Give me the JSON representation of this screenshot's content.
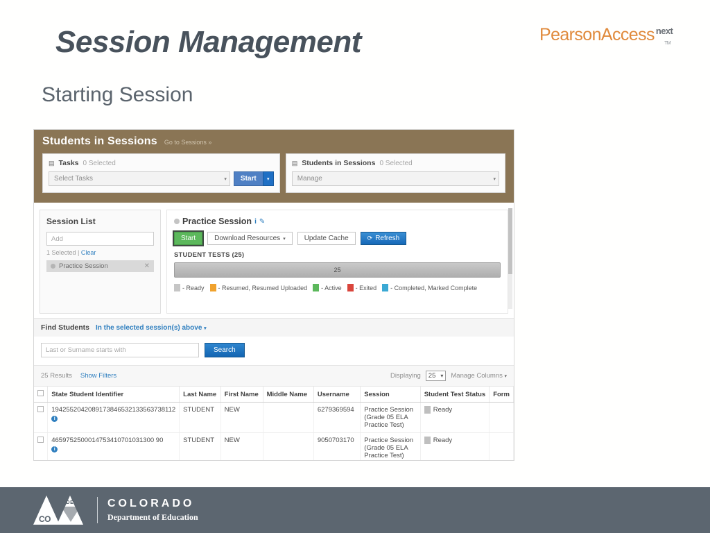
{
  "slide": {
    "title": "Session Management",
    "subtitle": "Starting Session"
  },
  "brand": {
    "pearson_word": "PearsonAccess",
    "pearson_next": "next",
    "pearson_tm": "TM",
    "accent_color": "#e08a3c"
  },
  "app": {
    "header": {
      "title": "Students in Sessions",
      "go_to_sessions": "Go to Sessions »",
      "tasks_panel": {
        "icon": "tasks-icon",
        "label": "Tasks",
        "selected_count": "0 Selected",
        "select_value": "Select Tasks",
        "start_label": "Start",
        "caret": "▾"
      },
      "sis_panel": {
        "icon": "card-icon",
        "label": "Students in Sessions",
        "selected_count": "0 Selected",
        "manage_value": "Manage",
        "caret": "▾"
      }
    },
    "session_list": {
      "title": "Session List",
      "add_placeholder": "Add",
      "selected_text": "1 Selected |",
      "clear_label": "Clear",
      "chip": {
        "label": "Practice Session",
        "remove": "✕"
      }
    },
    "session_detail": {
      "name": "Practice Session",
      "info_icon": "i",
      "edit_icon": "✎",
      "buttons": {
        "start": "Start",
        "download_resources": "Download Resources",
        "update_cache": "Update Cache",
        "refresh": "Refresh",
        "refresh_icon": "⟳",
        "caret": "▾"
      },
      "student_tests_label": "STUDENT TESTS (25)",
      "status_bar_value": "25",
      "legend": [
        {
          "color": "#c6c6c6",
          "label": "- Ready"
        },
        {
          "color": "#f0a22e",
          "label": "- Resumed, Resumed Uploaded"
        },
        {
          "color": "#5cb85c",
          "label": "- Active"
        },
        {
          "color": "#d9453c",
          "label": "- Exited"
        },
        {
          "color": "#3ba9d4",
          "label": "- Completed, Marked Complete"
        }
      ]
    },
    "find_students": {
      "title": "Find Students",
      "scope": "In the selected session(s) above",
      "caret": "▾",
      "search_placeholder": "Last or Surname starts with",
      "search_button": "Search",
      "results_count": "25 Results",
      "show_filters": "Show Filters",
      "displaying_label": "Displaying",
      "displaying_value": "25",
      "displaying_caret": "▾",
      "manage_columns": "Manage Columns",
      "manage_columns_caret": "▾"
    },
    "table": {
      "columns": [
        "State Student Identifier",
        "Last Name",
        "First Name",
        "Middle Name",
        "Username",
        "Session",
        "Student Test Status",
        "Form"
      ],
      "rows": [
        {
          "ssid": "1942552042089173846532133563738112",
          "last_name": "STUDENT",
          "first_name": "NEW",
          "middle_name": "",
          "username": "6279369594",
          "session": "Practice Session (Grade 05 ELA Practice Test)",
          "status": "Ready",
          "status_color": "#bfbfbf",
          "form": ""
        },
        {
          "ssid": "4659752500014753410701031300 90",
          "last_name": "STUDENT",
          "first_name": "NEW",
          "middle_name": "",
          "username": "9050703170",
          "session": "Practice Session (Grade 05 ELA Practice Test)",
          "status": "Ready",
          "status_color": "#bfbfbf",
          "form": ""
        }
      ]
    }
  },
  "footer": {
    "mark_co": "CO",
    "mark_cde": "CDE",
    "line1": "COLORADO",
    "line2": "Department of Education",
    "band_color": "#5c6670"
  }
}
